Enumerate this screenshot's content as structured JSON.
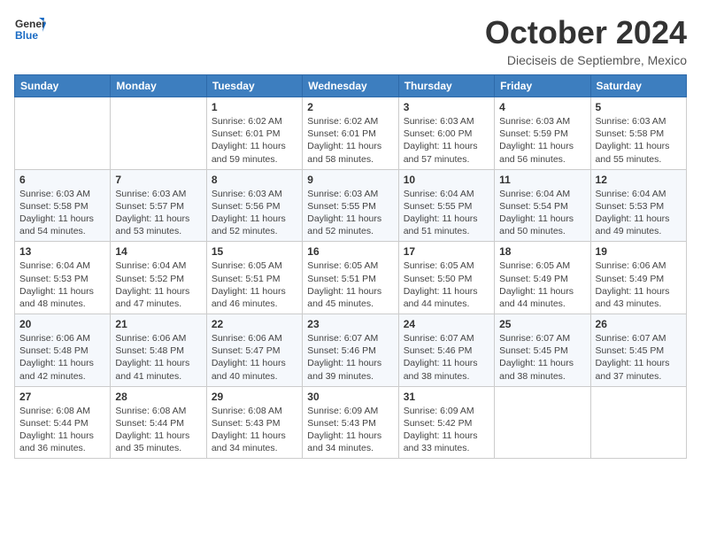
{
  "logo": {
    "text_general": "General",
    "text_blue": "Blue"
  },
  "header": {
    "month_title": "October 2024",
    "location": "Dieciseis de Septiembre, Mexico"
  },
  "weekdays": [
    "Sunday",
    "Monday",
    "Tuesday",
    "Wednesday",
    "Thursday",
    "Friday",
    "Saturday"
  ],
  "weeks": [
    [
      {
        "day": "",
        "info": ""
      },
      {
        "day": "",
        "info": ""
      },
      {
        "day": "1",
        "info": "Sunrise: 6:02 AM\nSunset: 6:01 PM\nDaylight: 11 hours and 59 minutes."
      },
      {
        "day": "2",
        "info": "Sunrise: 6:02 AM\nSunset: 6:01 PM\nDaylight: 11 hours and 58 minutes."
      },
      {
        "day": "3",
        "info": "Sunrise: 6:03 AM\nSunset: 6:00 PM\nDaylight: 11 hours and 57 minutes."
      },
      {
        "day": "4",
        "info": "Sunrise: 6:03 AM\nSunset: 5:59 PM\nDaylight: 11 hours and 56 minutes."
      },
      {
        "day": "5",
        "info": "Sunrise: 6:03 AM\nSunset: 5:58 PM\nDaylight: 11 hours and 55 minutes."
      }
    ],
    [
      {
        "day": "6",
        "info": "Sunrise: 6:03 AM\nSunset: 5:58 PM\nDaylight: 11 hours and 54 minutes."
      },
      {
        "day": "7",
        "info": "Sunrise: 6:03 AM\nSunset: 5:57 PM\nDaylight: 11 hours and 53 minutes."
      },
      {
        "day": "8",
        "info": "Sunrise: 6:03 AM\nSunset: 5:56 PM\nDaylight: 11 hours and 52 minutes."
      },
      {
        "day": "9",
        "info": "Sunrise: 6:03 AM\nSunset: 5:55 PM\nDaylight: 11 hours and 52 minutes."
      },
      {
        "day": "10",
        "info": "Sunrise: 6:04 AM\nSunset: 5:55 PM\nDaylight: 11 hours and 51 minutes."
      },
      {
        "day": "11",
        "info": "Sunrise: 6:04 AM\nSunset: 5:54 PM\nDaylight: 11 hours and 50 minutes."
      },
      {
        "day": "12",
        "info": "Sunrise: 6:04 AM\nSunset: 5:53 PM\nDaylight: 11 hours and 49 minutes."
      }
    ],
    [
      {
        "day": "13",
        "info": "Sunrise: 6:04 AM\nSunset: 5:53 PM\nDaylight: 11 hours and 48 minutes."
      },
      {
        "day": "14",
        "info": "Sunrise: 6:04 AM\nSunset: 5:52 PM\nDaylight: 11 hours and 47 minutes."
      },
      {
        "day": "15",
        "info": "Sunrise: 6:05 AM\nSunset: 5:51 PM\nDaylight: 11 hours and 46 minutes."
      },
      {
        "day": "16",
        "info": "Sunrise: 6:05 AM\nSunset: 5:51 PM\nDaylight: 11 hours and 45 minutes."
      },
      {
        "day": "17",
        "info": "Sunrise: 6:05 AM\nSunset: 5:50 PM\nDaylight: 11 hours and 44 minutes."
      },
      {
        "day": "18",
        "info": "Sunrise: 6:05 AM\nSunset: 5:49 PM\nDaylight: 11 hours and 44 minutes."
      },
      {
        "day": "19",
        "info": "Sunrise: 6:06 AM\nSunset: 5:49 PM\nDaylight: 11 hours and 43 minutes."
      }
    ],
    [
      {
        "day": "20",
        "info": "Sunrise: 6:06 AM\nSunset: 5:48 PM\nDaylight: 11 hours and 42 minutes."
      },
      {
        "day": "21",
        "info": "Sunrise: 6:06 AM\nSunset: 5:48 PM\nDaylight: 11 hours and 41 minutes."
      },
      {
        "day": "22",
        "info": "Sunrise: 6:06 AM\nSunset: 5:47 PM\nDaylight: 11 hours and 40 minutes."
      },
      {
        "day": "23",
        "info": "Sunrise: 6:07 AM\nSunset: 5:46 PM\nDaylight: 11 hours and 39 minutes."
      },
      {
        "day": "24",
        "info": "Sunrise: 6:07 AM\nSunset: 5:46 PM\nDaylight: 11 hours and 38 minutes."
      },
      {
        "day": "25",
        "info": "Sunrise: 6:07 AM\nSunset: 5:45 PM\nDaylight: 11 hours and 38 minutes."
      },
      {
        "day": "26",
        "info": "Sunrise: 6:07 AM\nSunset: 5:45 PM\nDaylight: 11 hours and 37 minutes."
      }
    ],
    [
      {
        "day": "27",
        "info": "Sunrise: 6:08 AM\nSunset: 5:44 PM\nDaylight: 11 hours and 36 minutes."
      },
      {
        "day": "28",
        "info": "Sunrise: 6:08 AM\nSunset: 5:44 PM\nDaylight: 11 hours and 35 minutes."
      },
      {
        "day": "29",
        "info": "Sunrise: 6:08 AM\nSunset: 5:43 PM\nDaylight: 11 hours and 34 minutes."
      },
      {
        "day": "30",
        "info": "Sunrise: 6:09 AM\nSunset: 5:43 PM\nDaylight: 11 hours and 34 minutes."
      },
      {
        "day": "31",
        "info": "Sunrise: 6:09 AM\nSunset: 5:42 PM\nDaylight: 11 hours and 33 minutes."
      },
      {
        "day": "",
        "info": ""
      },
      {
        "day": "",
        "info": ""
      }
    ]
  ]
}
